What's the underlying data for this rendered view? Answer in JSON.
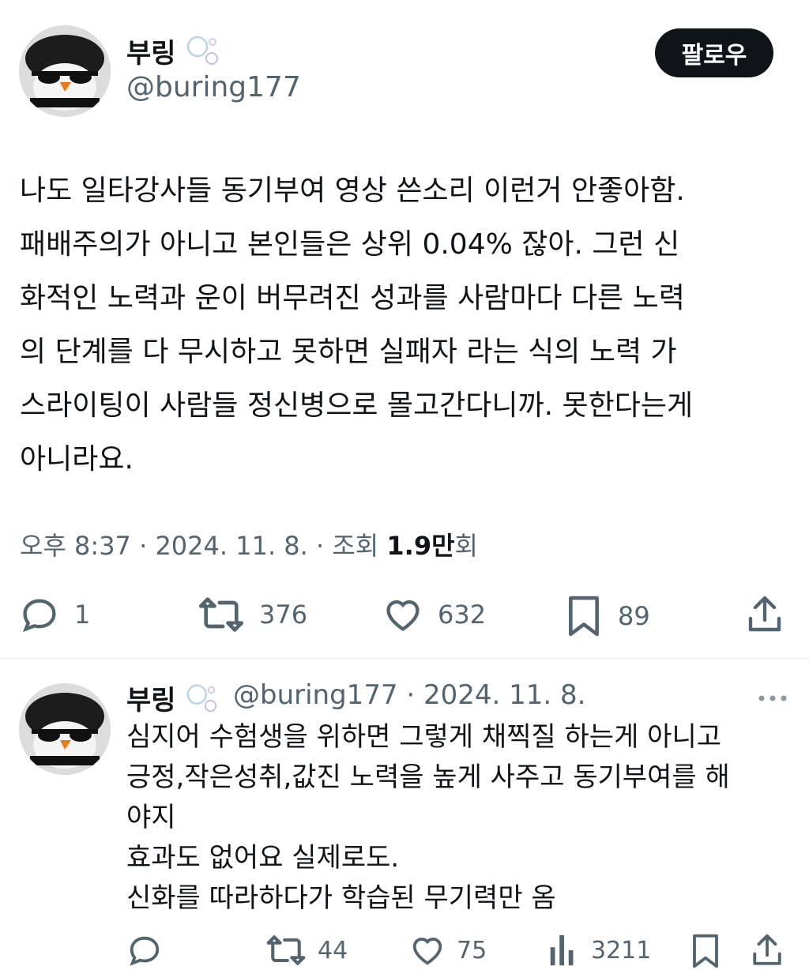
{
  "main_tweet": {
    "display_name": "부링",
    "handle": "@buring177",
    "follow_label": "팔로우",
    "lines": [
      "나도 일타강사들 동기부여 영상 쓴소리 이런거 안좋아함.",
      "패배주의가 아니고 본인들은 상위 0.04% 잖아. 그런 신",
      "화적인 노력과 운이 버무려진 성과를 사람마다 다른 노력",
      "의 단계를 다 무시하고 못하면 실패자 라는 식의 노력 가",
      "스라이팅이 사람들 정신병으로 몰고간다니까. 못한다는게",
      "아니라요."
    ],
    "time": "오후 8:37",
    "date": "2024. 11. 8.",
    "views_label": "조회",
    "views_count": "1.9만",
    "views_suffix": "회",
    "replies": "1",
    "retweets": "376",
    "likes": "632",
    "bookmarks": "89"
  },
  "reply_tweet": {
    "display_name": "부링",
    "handle_date": "@buring177 · 2024. 11. 8.",
    "lines": [
      "심지어 수험생을 위하면 그렇게 채찍질 하는게 아니고",
      "긍정,작은성취,값진 노력을 높게 사주고 동기부여를 해",
      "야지",
      "효과도 없어요 실제로도.",
      "신화를 따라하다가 학습된 무기력만 옴"
    ],
    "retweets": "44",
    "likes": "75",
    "views": "3211"
  },
  "colors": {
    "text": "#0f1419",
    "secondary": "#536471",
    "button_bg": "#0f1419",
    "divider": "#e6e9eb"
  }
}
